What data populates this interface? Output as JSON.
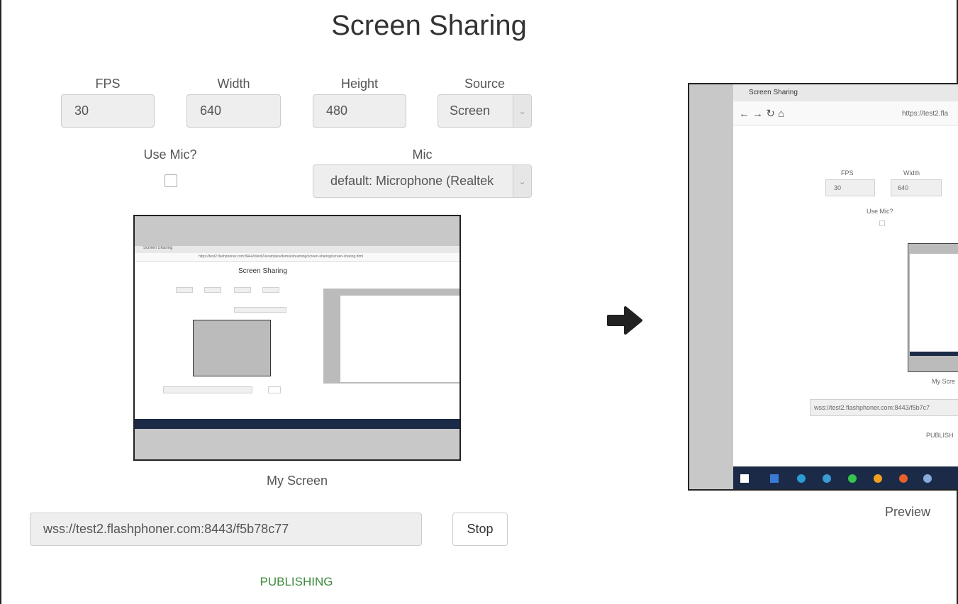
{
  "page": {
    "title": "Screen Sharing"
  },
  "form": {
    "fps": {
      "label": "FPS",
      "value": "30"
    },
    "width": {
      "label": "Width",
      "value": "640"
    },
    "height": {
      "label": "Height",
      "value": "480"
    },
    "source": {
      "label": "Source",
      "selected": "Screen"
    },
    "use_mic": {
      "label": "Use Mic?",
      "checked": false
    },
    "mic": {
      "label": "Mic",
      "selected": "default: Microphone (Realtek"
    }
  },
  "local_video": {
    "caption": "My Screen",
    "captured": {
      "page_title": "Screen Sharing",
      "tab_title": "Screen Sharing",
      "url": "https://test2.flashphoner.com:8444/client2/examples/demo/streaming/screen-sharing/screen-sharing.html"
    }
  },
  "connection": {
    "url_value": "wss://test2.flashphoner.com:8443/f5b78c77",
    "button_label": "Stop",
    "status": "PUBLISHING"
  },
  "remote_video": {
    "caption": "Preview",
    "captured": {
      "tab_title": "Screen Sharing",
      "url_fragment": "https://test2.fla",
      "fps_label": "FPS",
      "width_label": "Width",
      "fps_value": "30",
      "width_value": "640",
      "use_mic_label": "Use Mic?",
      "my_screen_caption": "My Scre",
      "url_value": "wss://test2.flashphoner.com:8443/f5b7c7",
      "status": "PUBLISH"
    }
  },
  "icons": {
    "arrow": "arrow-right-icon",
    "chevron": "chevron-down-icon"
  },
  "colors": {
    "status_green": "#3c8a3c",
    "taskbar": "#1b2a47",
    "arrow": "#222222"
  }
}
